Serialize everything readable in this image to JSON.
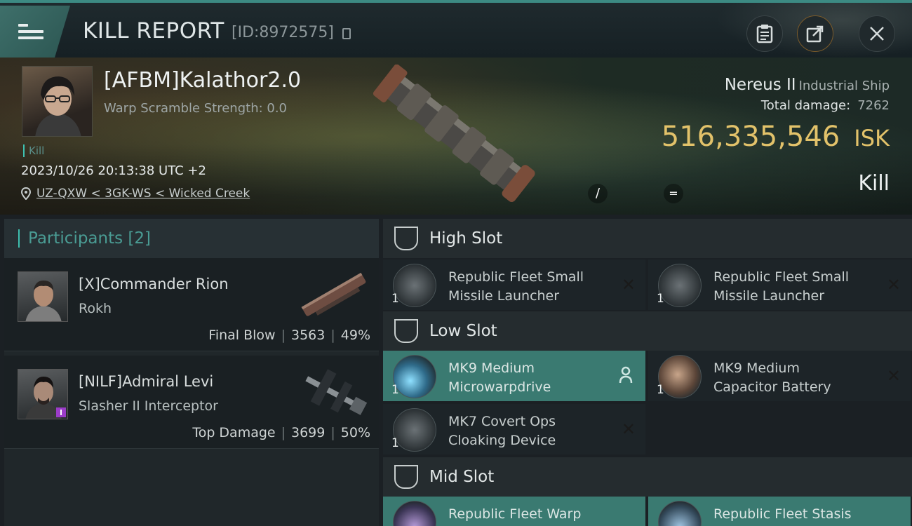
{
  "header": {
    "title": "KILL REPORT",
    "report_id": "[ID:8972575]"
  },
  "victim": {
    "name": "[AFBM]Kalathor2.0",
    "warp_scramble": "Warp Scramble Strength: 0.0",
    "tag": "Kill",
    "datetime": "2023/10/26 20:13:38 UTC +2",
    "location": "UZ-QXW < 3GK-WS < Wicked Creek",
    "ship_name": "Nereus II",
    "ship_class": "Industrial Ship",
    "total_damage_label": "Total damage:",
    "total_damage": "7262",
    "isk_value": "516,335,546",
    "isk_unit": "ISK",
    "result": "Kill",
    "glyph_a": "/",
    "glyph_b": "="
  },
  "participants": {
    "title": "Participants [2]",
    "items": [
      {
        "name": "[X]Commander Rion",
        "ship": "Rokh",
        "role": "Final Blow",
        "damage": "3563",
        "percent": "49%"
      },
      {
        "name": "[NILF]Admiral Levi",
        "ship": "Slasher II Interceptor",
        "role": "Top Damage",
        "damage": "3699",
        "percent": "50%"
      }
    ]
  },
  "fitting": {
    "high_slot": {
      "title": "High Slot",
      "modules": [
        {
          "name": "Republic Fleet Small Missile Launcher",
          "qty": "1"
        },
        {
          "name": "Republic Fleet Small Missile Launcher",
          "qty": "1"
        }
      ]
    },
    "low_slot": {
      "title": "Low Slot",
      "modules": [
        {
          "name": "MK9 Medium Microwarpdrive",
          "qty": "1"
        },
        {
          "name": "MK9 Medium Capacitor Battery",
          "qty": "1"
        },
        {
          "name": "MK7 Covert Ops Cloaking Device",
          "qty": "1"
        }
      ]
    },
    "mid_slot": {
      "title": "Mid Slot",
      "modules": [
        {
          "name": "Republic Fleet Warp",
          "qty": ""
        },
        {
          "name": "Republic Fleet Stasis",
          "qty": ""
        }
      ]
    }
  },
  "icons": {
    "menu": "hamburger-icon",
    "copy": "copy-icon",
    "clipboard": "clipboard-icon",
    "share": "share-icon",
    "close": "close-icon",
    "location": "map-pin-icon",
    "slot": "slot-shield-icon",
    "destroyed": "x-icon",
    "dropped": "person-icon"
  },
  "colors": {
    "accent": "#3ec0b0",
    "isk": "#e2c26a",
    "active_module": "#3a7a71"
  }
}
